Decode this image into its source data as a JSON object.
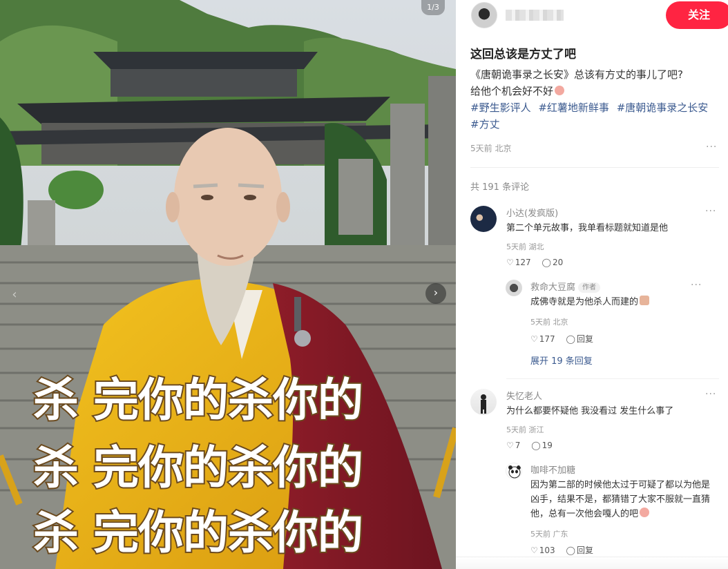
{
  "media": {
    "counter": "1/3",
    "prev_icon": "chevron-left-icon",
    "next_icon": "chevron-right-icon",
    "caption_lines": [
      "杀 完你的杀你的",
      "杀 完你的杀你的",
      "杀 完你的杀你的"
    ]
  },
  "author": {
    "follow_label": "关注"
  },
  "post": {
    "title": "这回总该是方丈了吧",
    "body_line1": "《唐朝诡事录之长安》总该有方丈的事儿了吧?",
    "body_line2": "给他个机会好不好",
    "tags": [
      "#野生影评人",
      "#红薯地新鲜事",
      "#唐朝诡事录之长安",
      "#方丈"
    ],
    "meta": "5天前 北京",
    "comment_count": "共 191 条评论"
  },
  "comments": [
    {
      "name": "小达(发疯版)",
      "text": "第二个单元故事，我单看标题就知道是他",
      "meta": "5天前 湖北",
      "likes": "127",
      "replies": "20"
    },
    {
      "name": "失忆老人",
      "text": "为什么都要怀疑他 我没看过 发生什么事了",
      "meta": "5天前 浙江",
      "likes": "7",
      "replies": "19"
    }
  ],
  "replies": [
    {
      "name": "救命大豆腐",
      "badge": "作者",
      "text": "成佛寺就是为他杀人而建的",
      "meta": "5天前 北京",
      "likes": "177",
      "reply_label": "回复"
    },
    {
      "name": "咖啡不加糖",
      "text": "因为第二部的时候他太过于可疑了都以为他是凶手，结果不是，都猜错了大家不服就一直猜他，总有一次他会嘎人的吧",
      "meta": "5天前 广东",
      "likes": "103",
      "reply_label": "回复"
    }
  ],
  "expand_label": "展开 19 条回复",
  "colors": {
    "accent": "#ff2442",
    "tag": "#3b5a8f"
  }
}
